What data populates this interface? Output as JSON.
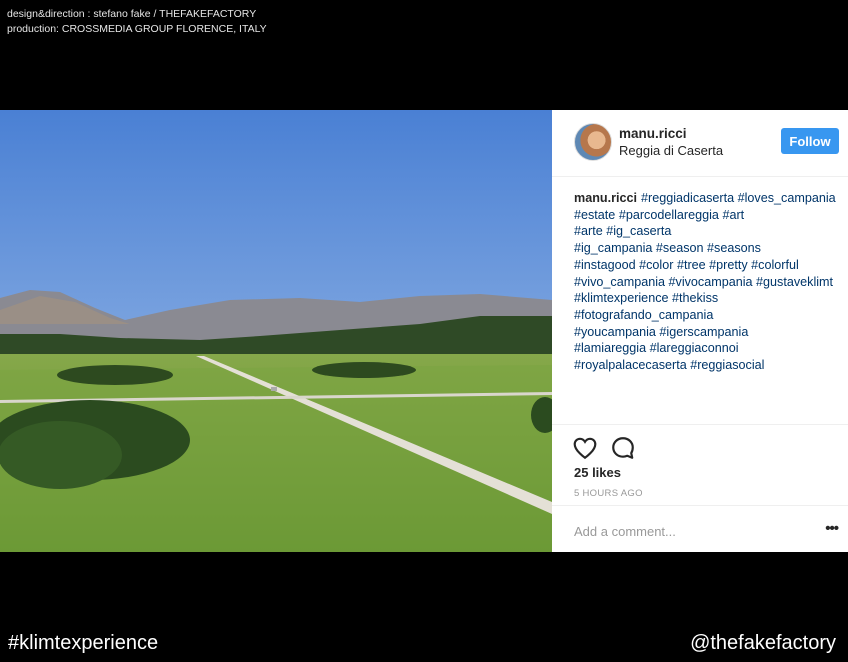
{
  "credits": {
    "line1": "design&direction : stefano fake / THEFAKEFACTORY",
    "line2": "production: CROSSMEDIA GROUP FLORENCE, ITALY"
  },
  "post": {
    "username": "manu.ricci",
    "location": "Reggia di Caserta",
    "follow_label": "Follow",
    "caption_author": "manu.ricci",
    "hashtags": [
      "#reggiadicaserta",
      "#loves_campania",
      "#estate",
      "#parcodellareggia",
      "#art",
      "#arte",
      "#ig_caserta",
      "#ig_campania",
      "#season",
      "#seasons",
      "#instagood",
      "#color",
      "#tree",
      "#pretty",
      "#colorful",
      "#vivo_campania",
      "#vivocampania",
      "#gustaveklimt",
      "#klimtexperience",
      "#thekiss",
      "#fotografando_campania",
      "#youcampania",
      "#igerscampania",
      "#lamiareggia",
      "#lareggiaconnoi",
      "#royalpalacecaserta",
      "#reggiasocial"
    ],
    "likes": "25 likes",
    "time": "5 HOURS AGO",
    "comment_placeholder": "Add a comment...",
    "more_label": "•••",
    "icons": {
      "like": "heart-icon",
      "comment": "comment-bubble-icon"
    },
    "colors": {
      "follow": "#3897f0",
      "hashtag": "#003569"
    }
  },
  "footer": {
    "left": "#klimtexperience",
    "right": "@thefakefactory"
  }
}
